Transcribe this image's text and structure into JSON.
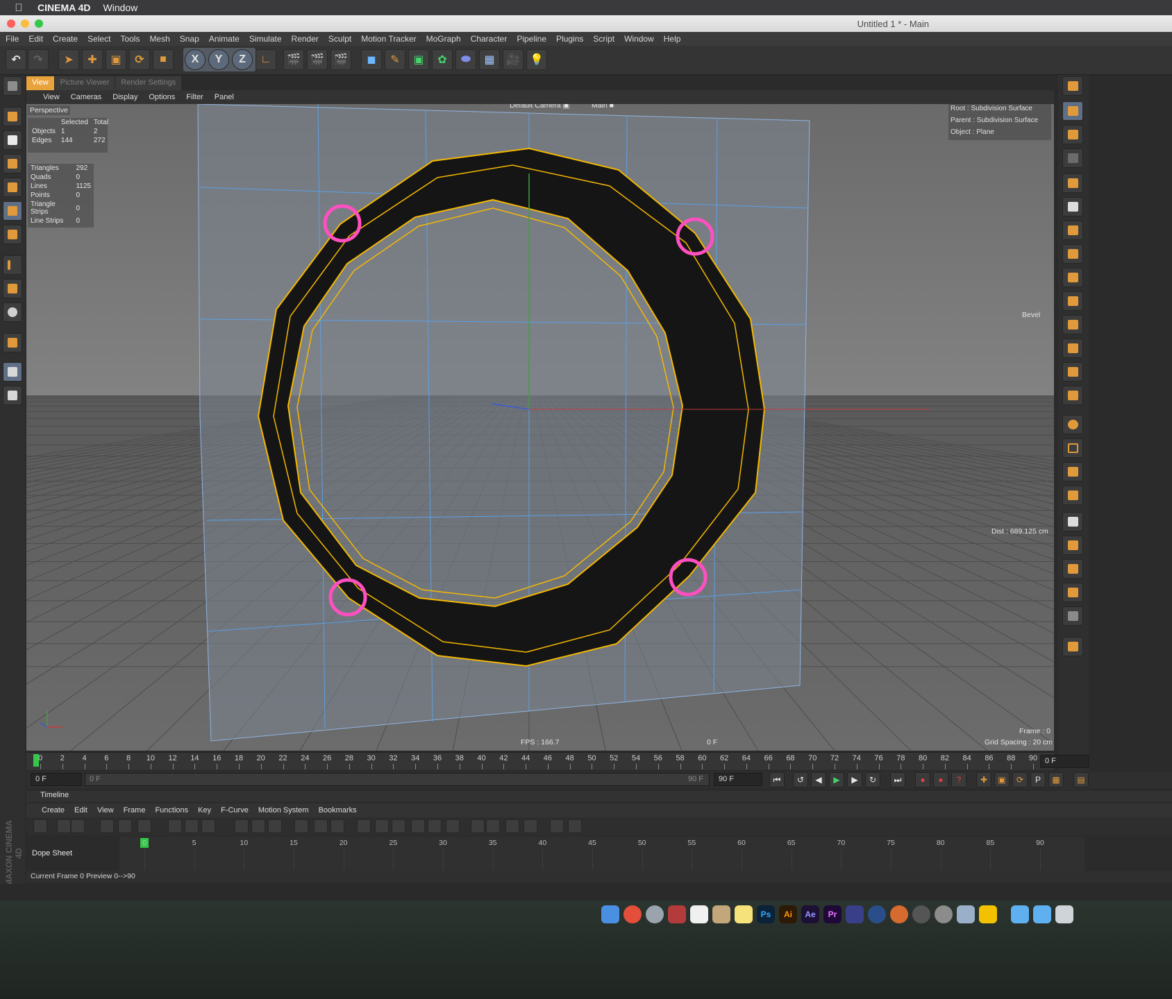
{
  "macbar": {
    "app_name": "CINEMA 4D",
    "menu": "Window"
  },
  "window": {
    "title": "Untitled 1 * - Main"
  },
  "app_menu": [
    "File",
    "Edit",
    "Create",
    "Select",
    "Tools",
    "Mesh",
    "Snap",
    "Animate",
    "Simulate",
    "Render",
    "Sculpt",
    "Motion Tracker",
    "MoGraph",
    "Character",
    "Pipeline",
    "Plugins",
    "Script",
    "Window",
    "Help"
  ],
  "toolbar": {
    "axis_x": "X",
    "axis_y": "Y",
    "axis_z": "Z"
  },
  "tabs": [
    "View",
    "Picture Viewer",
    "Render Settings"
  ],
  "viewport_menu": [
    "View",
    "Cameras",
    "Display",
    "Options",
    "Filter",
    "Panel"
  ],
  "viewport": {
    "name": "Perspective",
    "camera": "Default Camera",
    "take": "Main",
    "stats_header": {
      "selected": "Selected",
      "total": "Total"
    },
    "stats_rows": [
      {
        "label": "Objects",
        "selected": "1",
        "total": "2"
      },
      {
        "label": "Edges",
        "selected": "144",
        "total": "272"
      }
    ],
    "mesh_rows": [
      {
        "label": "Triangles",
        "value": "292"
      },
      {
        "label": "Quads",
        "value": "0"
      },
      {
        "label": "Lines",
        "value": "1125"
      },
      {
        "label": "Points",
        "value": "0"
      },
      {
        "label": "Triangle Strips",
        "value": "0"
      },
      {
        "label": "Line Strips",
        "value": "0"
      }
    ],
    "hierarchy": {
      "root": "Root : Subdivision Surface",
      "parent": "Parent : Subdivision Surface",
      "object": "Object : Plane"
    },
    "tool_label": "Bevel",
    "dist": "Dist : 689.125 cm",
    "fps": "FPS : 166.7",
    "frame_center": "0 F",
    "frame": "Frame : 0",
    "grid_spacing": "Grid Spacing : 20 cm",
    "axis_labels": {
      "y": "y",
      "z": "z",
      "x": "x"
    }
  },
  "ruler": {
    "ticks": [
      "0",
      "2",
      "4",
      "6",
      "8",
      "10",
      "12",
      "14",
      "16",
      "18",
      "20",
      "22",
      "24",
      "26",
      "28",
      "30",
      "32",
      "34",
      "36",
      "38",
      "40",
      "42",
      "44",
      "46",
      "48",
      "50",
      "52",
      "54",
      "56",
      "58",
      "60",
      "62",
      "64",
      "66",
      "68",
      "70",
      "72",
      "74",
      "76",
      "78",
      "80",
      "82",
      "84",
      "86",
      "88",
      "90"
    ],
    "end_field": "0 F"
  },
  "transport": {
    "start_field": "0 F",
    "slider_start": "0 F",
    "slider_end": "90 F",
    "end_field": "90 F"
  },
  "timeline": {
    "title": "Timeline",
    "menu": [
      "Create",
      "Edit",
      "View",
      "Frame",
      "Functions",
      "Key",
      "F-Curve",
      "Motion System",
      "Bookmarks"
    ],
    "mode": "Dope Sheet",
    "ticks": [
      "0",
      "5",
      "10",
      "15",
      "20",
      "25",
      "30",
      "35",
      "40",
      "45",
      "50",
      "55",
      "60",
      "65",
      "70",
      "75",
      "80",
      "85",
      "90"
    ],
    "status": "Current Frame  0  Preview  0-->90"
  },
  "branding": {
    "logo": "MAXON CINEMA 4D"
  },
  "dock": [
    "Ps",
    "Ai",
    "Ae",
    "Pr"
  ],
  "colors": {
    "accent_orange": "#e8a33d",
    "selection_yellow": "#f5b800",
    "highlight_pink": "#ff4fc0",
    "viewport_bg": "#6e6e6e",
    "wire_blue": "#5aa0e6"
  }
}
